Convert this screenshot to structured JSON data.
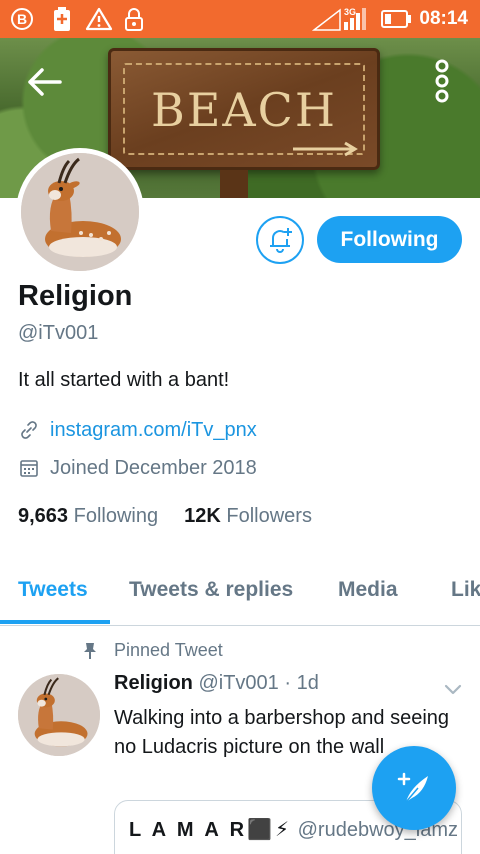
{
  "status_bar": {
    "time": "08:14",
    "network": "3G",
    "icons": [
      "b-badge-icon",
      "battery-saver-icon",
      "warning-icon",
      "lock-icon",
      "signal-icon",
      "battery-icon"
    ]
  },
  "banner": {
    "sign_text": "BEACH",
    "back_icon": "arrow-left-icon",
    "more_icon": "more-vertical-icon"
  },
  "profile": {
    "display_name": "Religion",
    "handle": "@iTv001",
    "bio": "It all started with a bant!",
    "link": "instagram.com/iTv_pnx",
    "joined": "Joined December 2018",
    "following_count": "9,663",
    "following_label": "Following",
    "followers_count": "12K",
    "followers_label": "Followers"
  },
  "actions": {
    "follow_label": "Following",
    "notification_icon": "bell-plus-icon"
  },
  "tabs": [
    {
      "label": "Tweets",
      "active": true
    },
    {
      "label": "Tweets & replies",
      "active": false
    },
    {
      "label": "Media",
      "active": false
    },
    {
      "label": "Lik",
      "active": false
    }
  ],
  "pinned_tweet": {
    "pin_label": "Pinned Tweet",
    "name": "Religion",
    "handle": "@iTv001",
    "time": "· 1d",
    "text": "Walking into a barbershop and seeing no Ludacris picture on the wall",
    "quote_name": "L A M A R⬛⚡",
    "quote_handle": "@rudebwoy_lamz"
  },
  "colors": {
    "status_bar": "#f26a2e",
    "accent": "#1da1f2",
    "link": "#1b95e0",
    "secondary_text": "#657786"
  }
}
